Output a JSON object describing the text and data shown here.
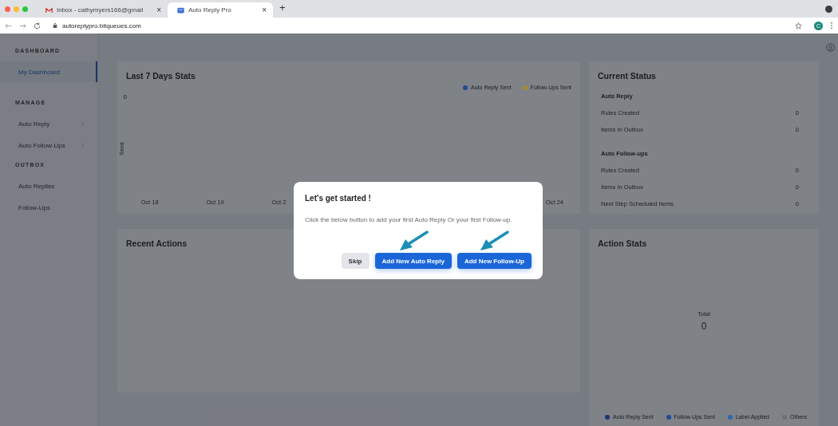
{
  "browser": {
    "tabs": [
      {
        "title": "Inbox - cathymyers166@gmail",
        "kind": "mail",
        "selected": false
      },
      {
        "title": "Auto Reply Pro",
        "kind": "app",
        "selected": true
      }
    ],
    "tab_close": "×",
    "new_tab": "+",
    "url": "autoreplypro.bitqueues.com",
    "profile_letter": "C"
  },
  "sidebar": {
    "sections": [
      {
        "heading": "DASHBOARD",
        "items": [
          {
            "label": "My Dashboard",
            "selected": true,
            "has_submenu": false
          }
        ]
      },
      {
        "heading": "MANAGE",
        "items": [
          {
            "label": "Auto Reply",
            "selected": false,
            "has_submenu": true
          },
          {
            "label": "Auto Follow-Ups",
            "selected": false,
            "has_submenu": true
          }
        ]
      },
      {
        "heading": "OUTBOX",
        "items": [
          {
            "label": "Auto Replies",
            "selected": false,
            "has_submenu": false
          },
          {
            "label": "Follow-Ups",
            "selected": false,
            "has_submenu": false
          }
        ]
      }
    ]
  },
  "stats_chart": {
    "title": "Last 7 Days Stats",
    "legend": [
      {
        "label": "Auto Reply Sent",
        "color": "#1f4b9a"
      },
      {
        "label": "Follow-Ups Sent",
        "color": "#a68a2c"
      }
    ],
    "y_tick": "0",
    "y_axis_label": "Sent",
    "x_labels": [
      "Oct 18",
      "Oct 19",
      "Oct 2",
      "Oct 24"
    ]
  },
  "current_status": {
    "title": "Current Status",
    "groups": [
      {
        "heading": "Auto Reply",
        "rows": [
          {
            "label": "Rules Created",
            "value": "0"
          },
          {
            "label": "Items In Outbox",
            "value": "0"
          }
        ]
      },
      {
        "heading": "Auto Follow-ups",
        "rows": [
          {
            "label": "Rules Created",
            "value": "0"
          },
          {
            "label": "Items In Outbox",
            "value": "0"
          },
          {
            "label": "Next Step Scheduled Items",
            "value": "0"
          }
        ]
      }
    ]
  },
  "recent_actions": {
    "title": "Recent Actions"
  },
  "action_stats": {
    "title": "Action Stats",
    "total_label": "Total",
    "total_value": "0",
    "legend": [
      {
        "label": "Auto Reply Sent",
        "color": "#1d3570"
      },
      {
        "label": "Follow-Ups Sent",
        "color": "#1f4b9a"
      },
      {
        "label": "Label Applied",
        "color": "#2e6ab0"
      },
      {
        "label": "Others",
        "color": "#6b717a"
      }
    ]
  },
  "modal": {
    "title": "Let's get started !",
    "message": "Click the below button to add your first Auto Reply Or your first Follow-up.",
    "buttons": [
      {
        "label": "Skip",
        "kind": "secondary",
        "arrow": false
      },
      {
        "label": "Add New Auto Reply",
        "kind": "primary",
        "arrow": true
      },
      {
        "label": "Add New Follow-Up",
        "kind": "primary",
        "arrow": true
      }
    ]
  }
}
